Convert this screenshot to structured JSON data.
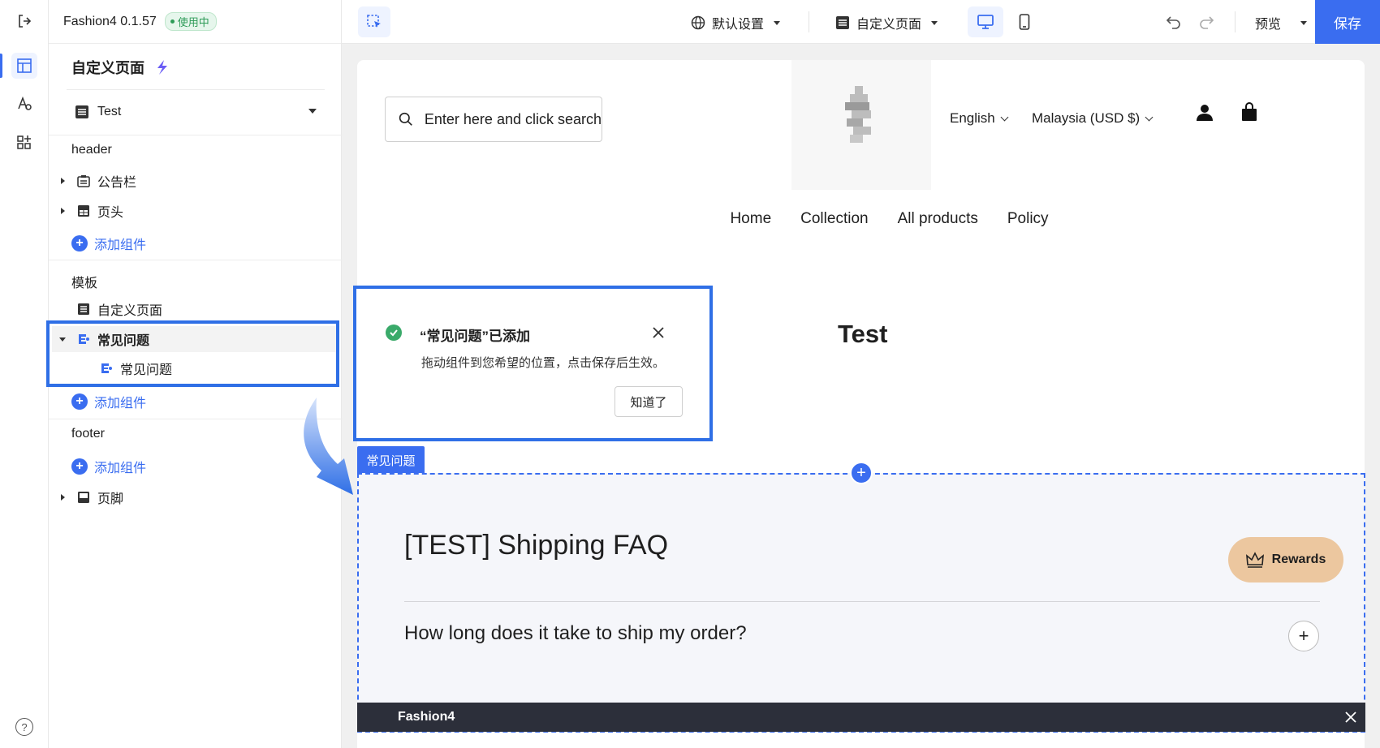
{
  "app": {
    "name": "Fashion4 0.1.57",
    "status": "使用中"
  },
  "sidebar": {
    "title": "自定义页面",
    "page_select": "Test",
    "header_label": "header",
    "header_items": [
      {
        "label": "公告栏"
      },
      {
        "label": "页头"
      }
    ],
    "add_component": "添加组件",
    "template_label": "模板",
    "template_items": [
      {
        "label": "自定义页面"
      },
      {
        "label": "常见问题"
      },
      {
        "label": "常见问题"
      }
    ],
    "footer_label": "footer",
    "footer_items": [
      {
        "label": "页脚"
      }
    ]
  },
  "toolbar": {
    "language": "默认设置",
    "page_type": "自定义页面",
    "preview": "预览",
    "save": "保存"
  },
  "preview_page": {
    "search_placeholder": "Enter here and click search",
    "language": "English",
    "currency": "Malaysia (USD $)",
    "nav": [
      "Home",
      "Collection",
      "All products",
      "Policy"
    ],
    "heading": "Test"
  },
  "toast": {
    "title": "“常见问题”已添加",
    "body": "拖动组件到您希望的位置，点击保存后生效。",
    "button": "知道了"
  },
  "faq_section": {
    "tag": "常见问题",
    "title": "[TEST] Shipping FAQ",
    "question": "How long does it take to ship my order?",
    "rewards": "Rewards"
  },
  "bottom_bar": {
    "name": "Fashion4"
  },
  "colors": {
    "accent": "#3a6df0",
    "highlight": "#2f6fe6",
    "success": "#3aaa6a",
    "rewards_bg": "#ecc79f"
  }
}
